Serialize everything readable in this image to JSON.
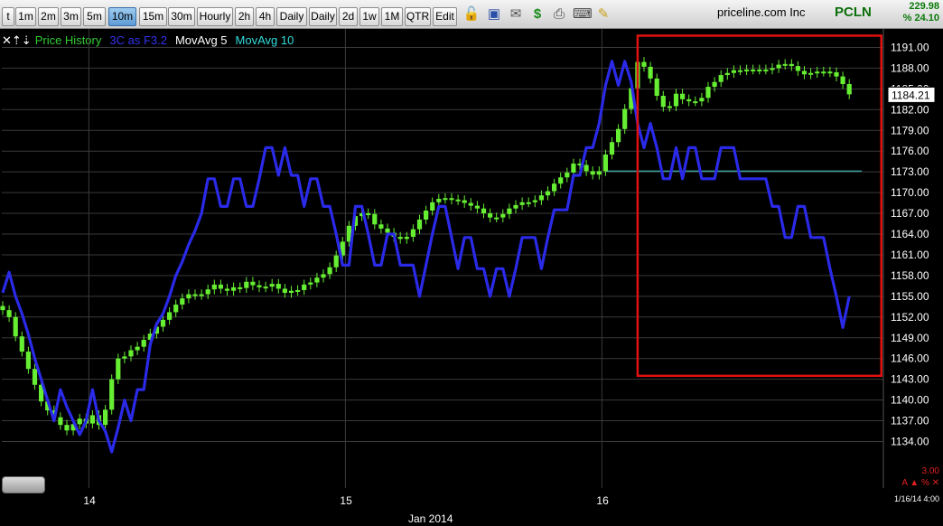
{
  "toolbar": {
    "intervals": [
      "t",
      "1m",
      "2m",
      "3m",
      "5m",
      "10m",
      "15m",
      "30m",
      "Hourly",
      "2h",
      "4h",
      "Daily",
      "Daily",
      "2d",
      "1w",
      "1M",
      "QTR",
      "Edit"
    ],
    "active_interval": "10m",
    "icons": [
      "lock-icon",
      "save-icon",
      "mail-icon",
      "dollar-icon",
      "print-icon",
      "keyboard-icon",
      "pencil-icon"
    ]
  },
  "header": {
    "company": "priceline.com Inc",
    "ticker": "PCLN",
    "last": "229.98",
    "change": "% 24.10"
  },
  "legend": {
    "prefix": "✕⇡⇣",
    "price_history": "Price History",
    "three_c": "3C as F3.2",
    "movavg5": "MovAvg 5",
    "movavg10": "MovAvg 10"
  },
  "colors": {
    "background": "#000000",
    "candle_up": "#66ee33",
    "indicator_line": "#2a2ae8",
    "highlight_box": "#e01010",
    "cyan_line": "#3a9ea0",
    "grid": "#3a3a3a",
    "legend_price": "#33cc33",
    "legend_3c": "#3333ee",
    "legend_ma5": "#ffffff",
    "legend_ma10": "#33dddd"
  },
  "footer": {
    "bottom_value": "3.00",
    "bottom_controls": "A ▲ % ✕",
    "timestamp": "1/16/14 4:00",
    "month": "Jan 2014"
  },
  "chart_data": {
    "type": "line",
    "x_ticks": [
      "14",
      "15",
      "16"
    ],
    "x_tick_bars": [
      14,
      54,
      94
    ],
    "bar_count": 133,
    "y_ticks": [
      1134,
      1137,
      1140,
      1143,
      1146,
      1149,
      1152,
      1155,
      1158,
      1161,
      1164,
      1167,
      1170,
      1173,
      1176,
      1179,
      1182,
      1185,
      1188,
      1191
    ],
    "ylim": [
      1131.5,
      1193.2
    ],
    "current_price": "1184.21",
    "reference_level": 1173.1,
    "reference_start_bar": 94,
    "highlight_region": {
      "bar_start": 99,
      "bar_end": 137,
      "y_low": 1143.5,
      "y_high": 1192.7
    },
    "series": [
      {
        "type": "candlestick",
        "close": [
          1153.0,
          1152.0,
          1149.2,
          1147.0,
          1144.5,
          1142.2,
          1139.8,
          1138.5,
          1137.5,
          1136.4,
          1135.6,
          1136.5,
          1137.3,
          1136.6,
          1137.8,
          1136.4,
          1138.6,
          1143.0,
          1146.0,
          1146.3,
          1147.2,
          1147.7,
          1148.7,
          1149.6,
          1150.6,
          1151.6,
          1152.7,
          1153.8,
          1154.7,
          1155.3,
          1155.2,
          1155.3,
          1156.0,
          1156.7,
          1156.1,
          1155.8,
          1156.3,
          1156.2,
          1157.1,
          1156.6,
          1156.3,
          1156.4,
          1156.8,
          1156.1,
          1155.5,
          1155.8,
          1155.9,
          1156.7,
          1157.0,
          1157.7,
          1158.2,
          1159.2,
          1160.9,
          1162.9,
          1165.2,
          1166.6,
          1167.0,
          1166.9,
          1165.4,
          1164.8,
          1164.2,
          1163.6,
          1163.3,
          1163.6,
          1164.7,
          1166.1,
          1167.4,
          1168.6,
          1169.1,
          1169.2,
          1169.0,
          1168.9,
          1168.5,
          1168.1,
          1167.7,
          1167.0,
          1166.4,
          1166.4,
          1166.9,
          1167.7,
          1168.2,
          1168.6,
          1168.6,
          1168.9,
          1169.6,
          1170.2,
          1171.3,
          1172.2,
          1172.9,
          1174.2,
          1174.0,
          1173.1,
          1172.6,
          1173.1,
          1175.5,
          1177.3,
          1179.2,
          1182.1,
          1185.1,
          1188.9,
          1188.2,
          1186.5,
          1184.0,
          1182.4,
          1182.5,
          1184.3,
          1183.5,
          1183.2,
          1183.2,
          1183.7,
          1185.3,
          1186.0,
          1187.0,
          1187.3,
          1187.7,
          1187.7,
          1187.8,
          1187.8,
          1187.8,
          1187.8,
          1188.0,
          1188.5,
          1188.6,
          1188.3,
          1187.6,
          1187.1,
          1187.3,
          1187.5,
          1187.5,
          1187.4,
          1186.8,
          1185.7,
          1184.21
        ]
      },
      {
        "name": "3C as F3.2",
        "values": [
          1155.5,
          1158.5,
          1155.0,
          1152.5,
          1149.5,
          1146.0,
          1143.0,
          1140.0,
          1137.0,
          1141.5,
          1139.0,
          1137.0,
          1135.0,
          1137.0,
          1141.5,
          1137.0,
          1135.5,
          1132.5,
          1136.0,
          1140.0,
          1137.0,
          1141.5,
          1141.5,
          1148.0,
          1151.0,
          1152.5,
          1155.0,
          1158.0,
          1160.0,
          1162.5,
          1164.5,
          1167.0,
          1172.0,
          1172.0,
          1168.0,
          1168.0,
          1172.0,
          1172.0,
          1168.0,
          1168.0,
          1172.0,
          1176.5,
          1176.5,
          1172.5,
          1176.5,
          1172.5,
          1172.5,
          1168.0,
          1172.0,
          1172.0,
          1168.0,
          1168.0,
          1164.0,
          1159.5,
          1159.5,
          1168.0,
          1168.0,
          1164.0,
          1159.5,
          1159.5,
          1164.0,
          1164.0,
          1159.5,
          1159.5,
          1159.5,
          1155.0,
          1159.5,
          1164.0,
          1168.0,
          1168.0,
          1163.5,
          1159.0,
          1163.5,
          1163.5,
          1159.0,
          1159.0,
          1155.0,
          1159.0,
          1159.0,
          1155.0,
          1159.0,
          1163.5,
          1163.5,
          1163.5,
          1159.0,
          1163.5,
          1167.5,
          1167.5,
          1167.5,
          1172.5,
          1172.5,
          1176.5,
          1176.5,
          1180.0,
          1185.5,
          1189.0,
          1185.5,
          1189.0,
          1186.0,
          1180.0,
          1176.5,
          1180.0,
          1176.5,
          1172.0,
          1172.0,
          1176.5,
          1172.0,
          1176.5,
          1176.5,
          1172.0,
          1172.0,
          1172.0,
          1176.5,
          1176.5,
          1176.5,
          1172.0,
          1172.0,
          1172.0,
          1172.0,
          1172.0,
          1168.0,
          1168.0,
          1163.5,
          1163.5,
          1168.0,
          1168.0,
          1163.5,
          1163.5,
          1163.5,
          1159.0,
          1155.0,
          1150.5,
          1155.0
        ]
      }
    ]
  }
}
